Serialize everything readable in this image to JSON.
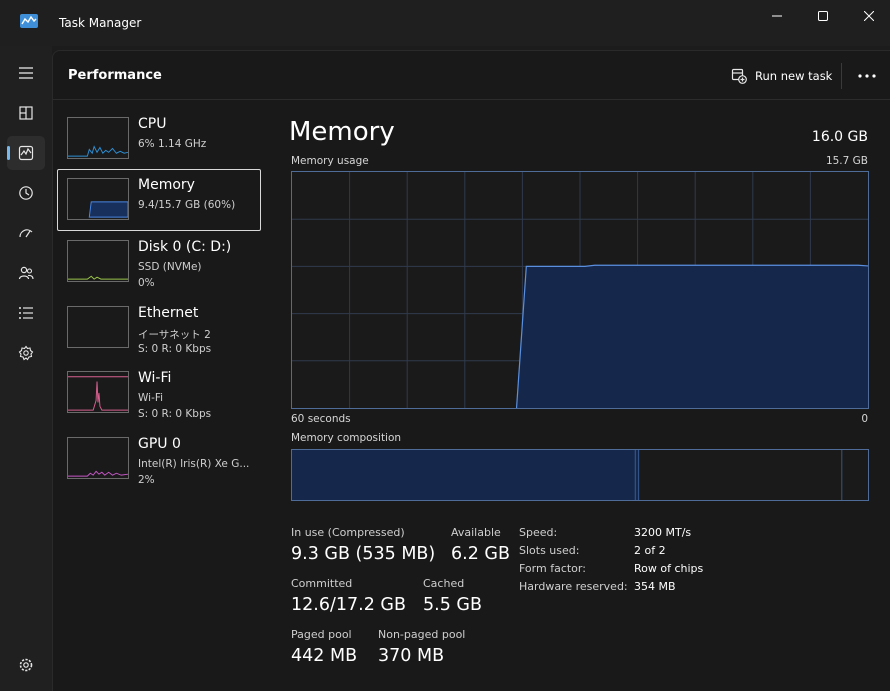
{
  "window": {
    "title": "Task Manager",
    "accent_color": "#76b9ed"
  },
  "header": {
    "title": "Performance",
    "run_new_task_label": "Run new task",
    "more_icon": "more-horizontal-icon"
  },
  "rail": {
    "items": [
      "hamburger-menu-icon",
      "processes-icon",
      "performance-icon",
      "app-history-icon",
      "startup-apps-icon",
      "users-icon",
      "details-icon",
      "services-icon"
    ],
    "bottom_item": "settings-gear-icon",
    "active_index": 2
  },
  "devices": [
    {
      "name": "CPU",
      "lines": [
        "6% 1.14 GHz"
      ],
      "color": "#2d8fd5"
    },
    {
      "name": "Memory",
      "lines": [
        "9.4/15.7 GB (60%)"
      ],
      "color": "#4a86e8",
      "selected": true
    },
    {
      "name": "Disk 0 (C: D:)",
      "lines": [
        "SSD (NVMe)",
        "0%"
      ],
      "color": "#9ac34a"
    },
    {
      "name": "Ethernet",
      "lines": [
        "イーサネット 2",
        "S: 0 R: 0 Kbps"
      ],
      "color": "#a58cd1"
    },
    {
      "name": "Wi-Fi",
      "lines": [
        "Wi-Fi",
        "S: 0 R: 0 Kbps"
      ],
      "color": "#d8608f"
    },
    {
      "name": "GPU 0",
      "lines": [
        "Intel(R) Iris(R) Xe G...",
        "2%"
      ],
      "color": "#c757c7"
    }
  ],
  "memory": {
    "title": "Memory",
    "total": "16.0 GB",
    "usage_label": "Memory usage",
    "usage_max": "15.7 GB",
    "time_label": "60 seconds",
    "time_min": "0",
    "composition_label": "Memory composition",
    "usage_history_fraction": [
      0,
      0,
      0,
      0,
      0,
      0,
      0,
      0,
      0,
      0,
      0,
      0,
      0,
      0,
      0,
      0,
      0,
      0,
      0,
      0,
      0,
      0,
      0,
      0,
      0.6,
      0.6,
      0.6,
      0.6,
      0.6,
      0.6,
      0.6,
      0.605,
      0.605,
      0.605,
      0.605,
      0.605,
      0.605,
      0.605,
      0.605,
      0.605,
      0.605,
      0.605,
      0.605,
      0.605,
      0.605,
      0.605,
      0.605,
      0.605,
      0.605,
      0.605,
      0.605,
      0.605,
      0.605,
      0.605,
      0.605,
      0.605,
      0.605,
      0.605,
      0.605,
      0.602
    ],
    "composition_segments_gb": {
      "in_use": 9.3,
      "modified": 0.1,
      "standby": 5.5,
      "free": 0.7
    }
  },
  "stats": {
    "in_use_label": "In use (Compressed)",
    "in_use_value": "9.3 GB (535 MB)",
    "available_label": "Available",
    "available_value": "6.2 GB",
    "committed_label": "Committed",
    "committed_value": "12.6/17.2 GB",
    "cached_label": "Cached",
    "cached_value": "5.5 GB",
    "paged_label": "Paged pool",
    "paged_value": "442 MB",
    "nonpaged_label": "Non-paged pool",
    "nonpaged_value": "370 MB"
  },
  "details": [
    {
      "label": "Speed:",
      "value": "3200 MT/s"
    },
    {
      "label": "Slots used:",
      "value": "2 of 2"
    },
    {
      "label": "Form factor:",
      "value": "Row of chips"
    },
    {
      "label": "Hardware reserved:",
      "value": "354 MB"
    }
  ]
}
